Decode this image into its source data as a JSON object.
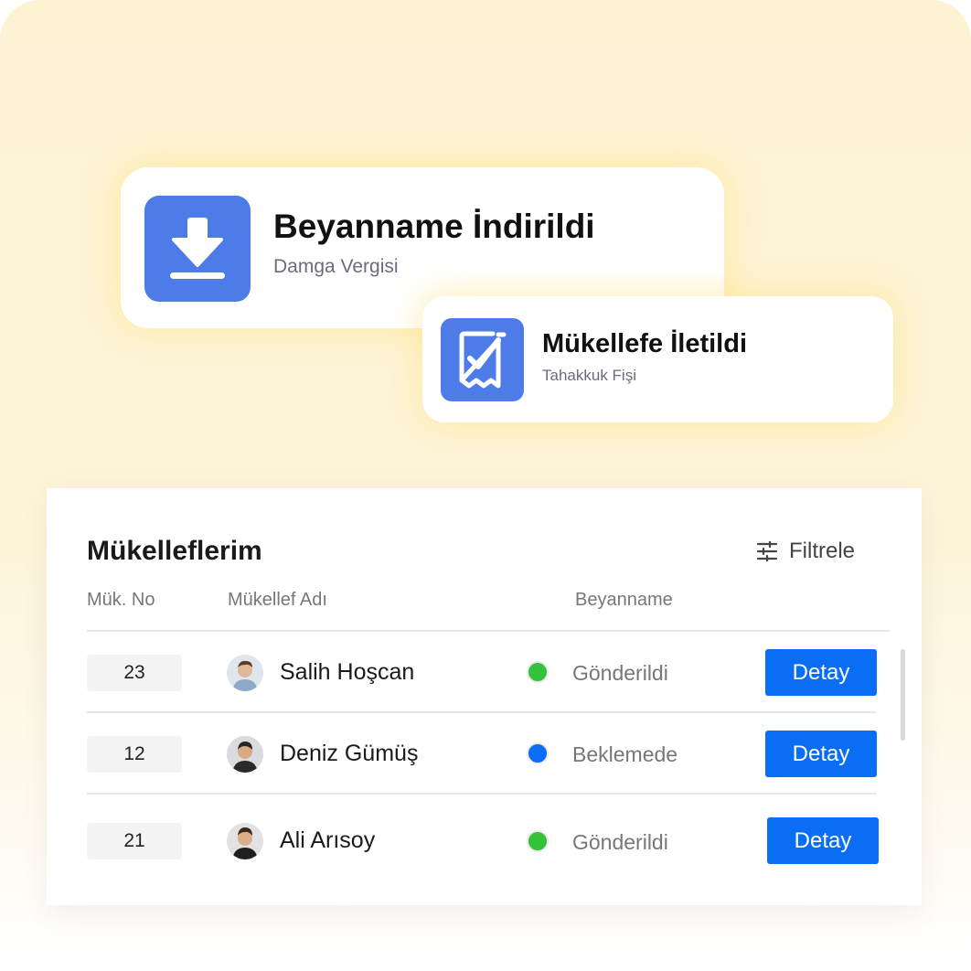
{
  "colors": {
    "accent": "#4d7be8",
    "button": "#0a6ef5",
    "status_sent": "#34c23a",
    "status_pending": "#0a6ef5"
  },
  "notification1": {
    "icon": "download-icon",
    "title": "Beyanname İndirildi",
    "subtitle": "Damga Vergisi"
  },
  "notification2": {
    "icon": "receipt-check-icon",
    "title": "Mükellefe İletildi",
    "subtitle": "Tahakkuk Fişi"
  },
  "panel": {
    "title": "Mükelleflerim",
    "filter_label": "Filtrele",
    "columns": [
      "Mük. No",
      "Mükellef Adı",
      "Beyanname"
    ],
    "action_label": "Detay",
    "rows": [
      {
        "no": "23",
        "name": "Salih Hoşcan",
        "status": "Gönderildi",
        "status_color": "#34c23a"
      },
      {
        "no": "12",
        "name": "Deniz Gümüş",
        "status": "Beklemede",
        "status_color": "#0a6ef5"
      },
      {
        "no": "21",
        "name": "Ali Arısoy",
        "status": "Gönderildi",
        "status_color": "#34c23a"
      }
    ]
  }
}
